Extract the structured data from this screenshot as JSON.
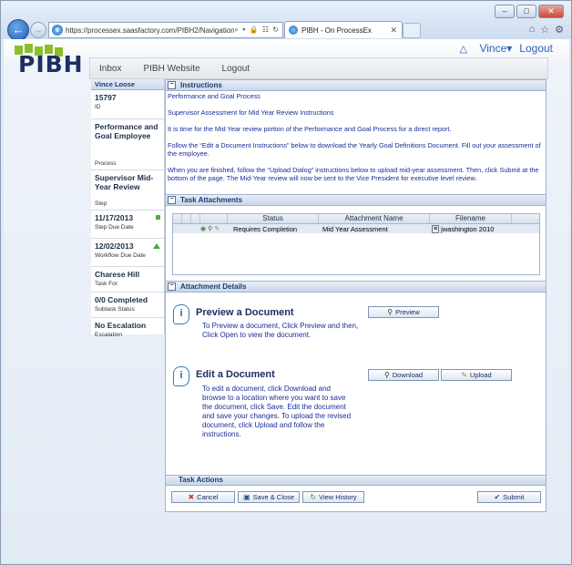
{
  "browser": {
    "url": "https://processex.saasfactory.com/PIBH2/Navigation_Co",
    "url_tools": "⌕ ▾ 🔒 ☷ ↻",
    "tab_title": "PIBH - On ProcessEx",
    "tab_close": "✕",
    "min": "–",
    "max": "□",
    "close": "✕",
    "home_icon": "⌂",
    "star_icon": "☆",
    "gear_icon": "⚙",
    "back": "←",
    "forward": "→"
  },
  "header": {
    "logo": "PIBH",
    "user_name": "Vince",
    "user_caret": "▾",
    "logout": "Logout"
  },
  "nav": [
    "Inbox",
    "PIBH Website",
    "Logout"
  ],
  "left": {
    "header": "Vince Loose",
    "cells": [
      {
        "value": "15797",
        "key": "ID"
      },
      {
        "value": "Performance and Goal Employee",
        "key": "Process"
      },
      {
        "value": "Supervisor Mid-Year Review",
        "key": "Step"
      },
      {
        "value": "11/17/2013",
        "key": "Step Due Date"
      },
      {
        "value": "12/02/2013",
        "key": "Workflow Due Date"
      },
      {
        "value": "Charese Hill",
        "key": "Task For"
      },
      {
        "value": "0/0 Completed",
        "key": "Subtask Status"
      },
      {
        "value": "No Escalation",
        "key": "Escalation"
      }
    ]
  },
  "instructions": {
    "title": "Instructions",
    "toggle": "−",
    "lines": [
      "Performance and Goal Process",
      "Supervisor Assessment for Mid Year Review Instructions",
      "It is time for the Mid Year review portion of the Performance and Goal Process for a direct report.",
      "Follow the “Edit a Document Instructions” below to download the Yearly Goal Definitions Document. Fill out your assessment of the employee.",
      "When you are finished, follow the “Upload Dialog” instructions below to upload mid-year assessment.  Then, click Submit at the bottom of the page. The Mid-Year review will now be sent to the Vice President for executive level review."
    ]
  },
  "attachments": {
    "title": "Task Attachments",
    "toggle": "−",
    "columns": [
      "Status",
      "Attachment Name",
      "Filename"
    ],
    "row": {
      "status": "Requires Completion",
      "name": "Mid Year Assessment",
      "filename": "jwashington 2010"
    }
  },
  "details": {
    "title": "Attachment Details",
    "toggle": "−",
    "preview_title": "Preview a Document",
    "preview_text": "To Preview a document, Click Preview and then, Click Open to view the document.",
    "preview_button": "Preview",
    "edit_title": "Edit a Document",
    "edit_text": "To edit a document, click Download and browse to a location where you want to save the document, click Save. Edit the document and save your changes. To upload the revised document, click Upload and follow the instructions.",
    "download_button": "Download",
    "upload_button": "Upload"
  },
  "actions": {
    "title": "Task Actions",
    "cancel": "Cancel",
    "save_close": "Save & Close",
    "history": "View History",
    "submit": "Submit"
  }
}
